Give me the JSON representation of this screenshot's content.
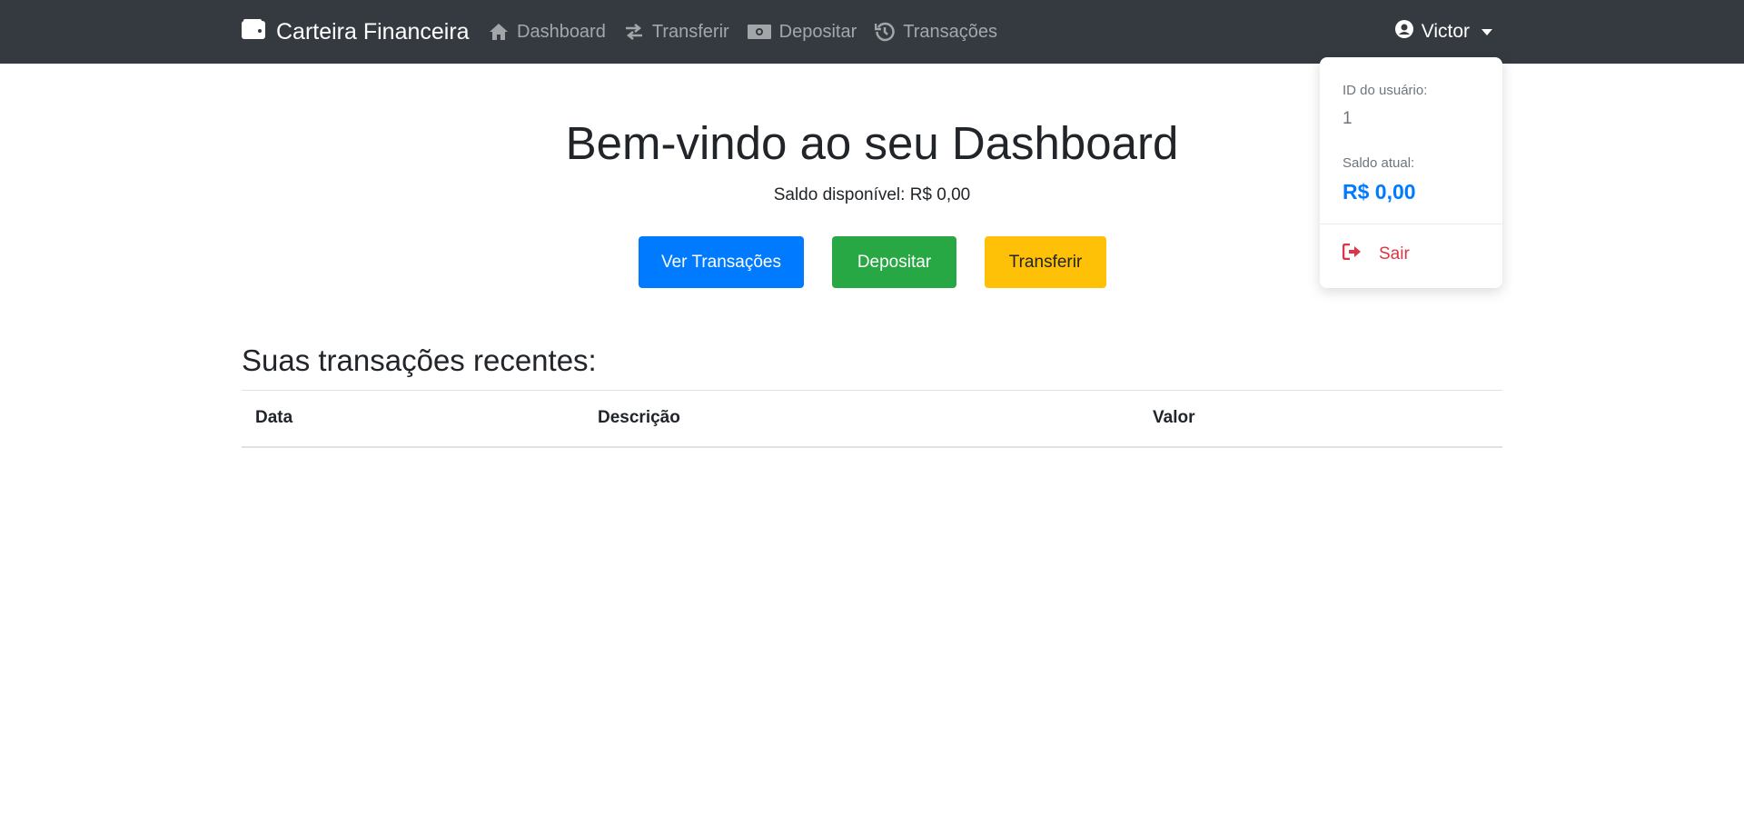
{
  "navbar": {
    "brand": "Carteira Financeira",
    "links": [
      {
        "label": "Dashboard",
        "icon": "home-icon"
      },
      {
        "label": "Transferir",
        "icon": "exchange-icon"
      },
      {
        "label": "Depositar",
        "icon": "money-icon"
      },
      {
        "label": "Transações",
        "icon": "history-icon"
      }
    ],
    "user": "Victor"
  },
  "dropdown": {
    "id_label": "ID do usuário:",
    "id_value": "1",
    "balance_label": "Saldo atual:",
    "balance_value": "R$ 0,00",
    "logout_label": "Sair"
  },
  "main": {
    "title": "Bem-vindo ao seu Dashboard",
    "balance_text": "Saldo disponível: R$ 0,00",
    "buttons": {
      "transactions": "Ver Transações",
      "deposit": "Depositar",
      "transfer": "Transferir"
    },
    "section_title": "Suas transações recentes:",
    "table": {
      "headers": [
        "Data",
        "Descrição",
        "Valor"
      ],
      "rows": []
    }
  },
  "colors": {
    "navbar": "#343a40",
    "primary": "#007bff",
    "success": "#28a745",
    "warning": "#ffc107",
    "danger": "#dc3545"
  }
}
